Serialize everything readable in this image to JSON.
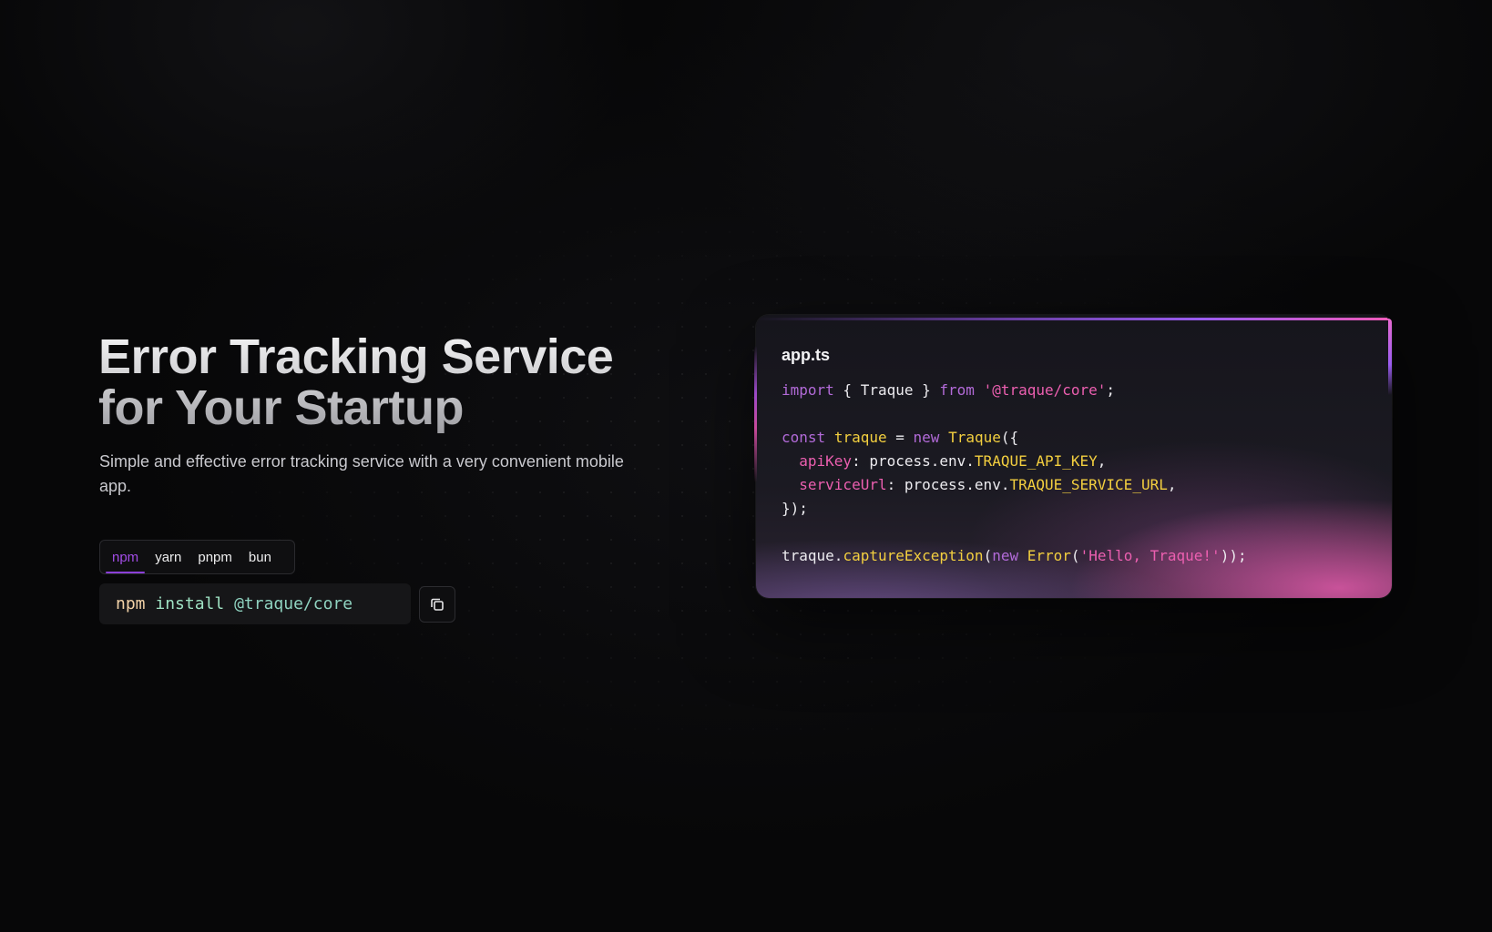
{
  "hero": {
    "title_line1": "Error Tracking Service",
    "title_line2": "for Your Startup",
    "subtitle": "Simple and effective error tracking service with a very convenient mobile app."
  },
  "install": {
    "tabs": [
      {
        "label": "npm",
        "active": true
      },
      {
        "label": "yarn",
        "active": false
      },
      {
        "label": "pnpm",
        "active": false
      },
      {
        "label": "bun",
        "active": false
      }
    ],
    "command": {
      "manager": "npm",
      "action": "install",
      "package": "@traque/core"
    },
    "copy_icon": "copy-icon"
  },
  "code_card": {
    "filename": "app.ts",
    "lines": [
      [
        {
          "t": "import",
          "c": "k"
        },
        {
          "t": " { Traque } ",
          "c": "w"
        },
        {
          "t": "from",
          "c": "k"
        },
        {
          "t": " ",
          "c": "w"
        },
        {
          "t": "'@traque/core'",
          "c": "s"
        },
        {
          "t": ";",
          "c": "w"
        }
      ],
      [],
      [
        {
          "t": "const",
          "c": "k"
        },
        {
          "t": " ",
          "c": "w"
        },
        {
          "t": "traque",
          "c": "y"
        },
        {
          "t": " = ",
          "c": "w"
        },
        {
          "t": "new",
          "c": "k"
        },
        {
          "t": " ",
          "c": "w"
        },
        {
          "t": "Traque",
          "c": "y"
        },
        {
          "t": "({",
          "c": "w"
        }
      ],
      [
        {
          "t": "  ",
          "c": "w"
        },
        {
          "t": "apiKey",
          "c": "p"
        },
        {
          "t": ": process.env.",
          "c": "w"
        },
        {
          "t": "TRAQUE_API_KEY",
          "c": "y"
        },
        {
          "t": ",",
          "c": "w"
        }
      ],
      [
        {
          "t": "  ",
          "c": "w"
        },
        {
          "t": "serviceUrl",
          "c": "p"
        },
        {
          "t": ": process.env.",
          "c": "w"
        },
        {
          "t": "TRAQUE_SERVICE_URL",
          "c": "y"
        },
        {
          "t": ",",
          "c": "w"
        }
      ],
      [
        {
          "t": "});",
          "c": "w"
        }
      ],
      [],
      [
        {
          "t": "traque.",
          "c": "w"
        },
        {
          "t": "captureException",
          "c": "y"
        },
        {
          "t": "(",
          "c": "w"
        },
        {
          "t": "new",
          "c": "k"
        },
        {
          "t": " ",
          "c": "w"
        },
        {
          "t": "Error",
          "c": "y"
        },
        {
          "t": "(",
          "c": "w"
        },
        {
          "t": "'Hello, Traque!'",
          "c": "s"
        },
        {
          "t": "));",
          "c": "w"
        }
      ]
    ]
  },
  "colors": {
    "accent_purple": "#8b3fd8",
    "accent_pink": "#ec5fb0",
    "keyword": "#b26ad8",
    "identifier": "#f3cf3f"
  }
}
